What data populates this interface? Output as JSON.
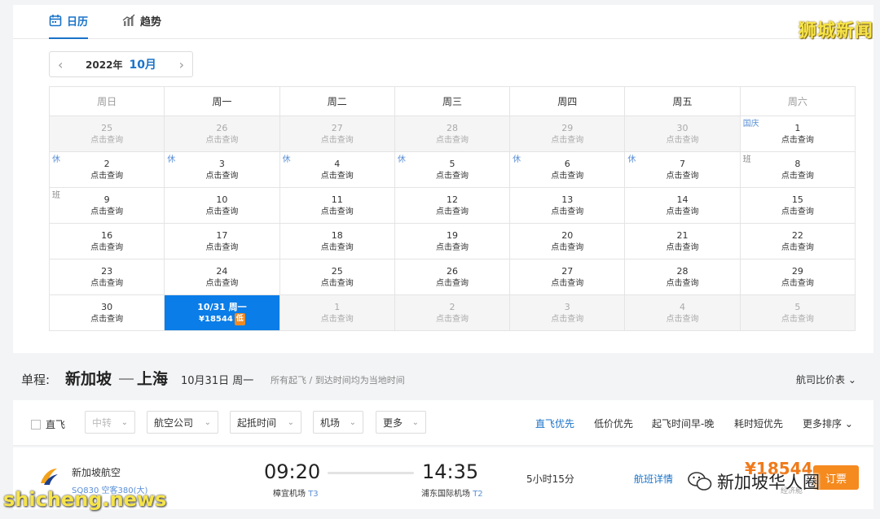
{
  "tabs": [
    {
      "label": "日历",
      "icon": "calendar-icon",
      "active": true
    },
    {
      "label": "趋势",
      "icon": "trend-chart-icon",
      "active": false
    }
  ],
  "watermark_top": "狮城新闻",
  "month_nav": {
    "year": "2022年",
    "month": "10月"
  },
  "weekdays": [
    "周日",
    "周一",
    "周二",
    "周三",
    "周四",
    "周五",
    "周六"
  ],
  "query_text": "点击查询",
  "weeks": [
    [
      {
        "day": "25",
        "out": true
      },
      {
        "day": "26",
        "out": true
      },
      {
        "day": "27",
        "out": true
      },
      {
        "day": "28",
        "out": true
      },
      {
        "day": "29",
        "out": true
      },
      {
        "day": "30",
        "out": true
      },
      {
        "day": "1",
        "tag": "国庆"
      }
    ],
    [
      {
        "day": "2",
        "tag": "休"
      },
      {
        "day": "3",
        "tag": "休"
      },
      {
        "day": "4",
        "tag": "休"
      },
      {
        "day": "5",
        "tag": "休"
      },
      {
        "day": "6",
        "tag": "休"
      },
      {
        "day": "7",
        "tag": "休"
      },
      {
        "day": "8",
        "tag": "班",
        "ban": true
      }
    ],
    [
      {
        "day": "9",
        "tag": "班",
        "ban": true
      },
      {
        "day": "10"
      },
      {
        "day": "11"
      },
      {
        "day": "12"
      },
      {
        "day": "13"
      },
      {
        "day": "14"
      },
      {
        "day": "15"
      }
    ],
    [
      {
        "day": "16"
      },
      {
        "day": "17"
      },
      {
        "day": "18"
      },
      {
        "day": "19"
      },
      {
        "day": "20"
      },
      {
        "day": "21"
      },
      {
        "day": "22"
      }
    ],
    [
      {
        "day": "23"
      },
      {
        "day": "24"
      },
      {
        "day": "25"
      },
      {
        "day": "26"
      },
      {
        "day": "27"
      },
      {
        "day": "28"
      },
      {
        "day": "29"
      }
    ],
    [
      {
        "day": "30"
      },
      {
        "day": "10/31 周一",
        "selected": true,
        "price": "¥18544",
        "badge": "低"
      },
      {
        "day": "1",
        "out": true
      },
      {
        "day": "2",
        "out": true
      },
      {
        "day": "3",
        "out": true
      },
      {
        "day": "4",
        "out": true
      },
      {
        "day": "5",
        "out": true
      }
    ]
  ],
  "route": {
    "label": "单程:",
    "from": "新加坡",
    "to": "上海",
    "date": "10月31日 周一",
    "note": "所有起飞 / 到达时间均为当地时间",
    "compare": "航司比价表"
  },
  "filters": {
    "direct_label": "直飞",
    "dropdowns": [
      "中转",
      "航空公司",
      "起抵时间",
      "机场",
      "更多"
    ],
    "sorts": [
      "直飞优先",
      "低价优先",
      "起飞时间早-晚",
      "耗时短优先",
      "更多排序"
    ]
  },
  "flight": {
    "airline": "新加坡航空",
    "flight_no": "SQ830 空客380(大)",
    "dep_time": "09:20",
    "dep_airport": "樟宜机场",
    "dep_terminal": "T3",
    "arr_time": "14:35",
    "arr_airport": "浦东国际机场",
    "arr_terminal": "T2",
    "duration": "5小时15分",
    "detail": "航班详情",
    "price": "¥18544",
    "price_sub": "经济舱",
    "book": "订票"
  },
  "watermark_brand": "新加坡华人圈",
  "watermark_site": "shicheng.news",
  "colors": {
    "accent": "#1a73c9",
    "selected": "#0a7de8",
    "price": "#f07a1a"
  }
}
